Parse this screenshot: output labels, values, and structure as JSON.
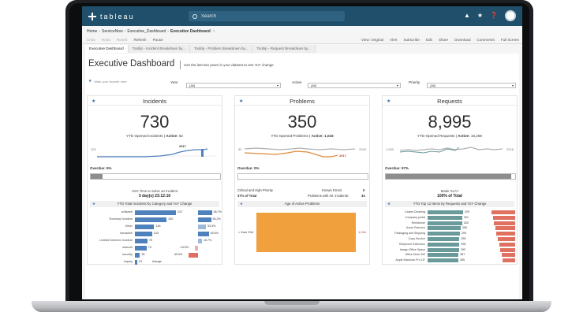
{
  "app": {
    "logo_text": "tableau",
    "search_placeholder": "Search"
  },
  "breadcrumb": [
    "Home",
    "ServiceNow",
    "Executive_Dashboard",
    "Executive Dashboard"
  ],
  "toolbar": {
    "left": [
      "Undo",
      "Redo",
      "Revert",
      "Refresh",
      "Pause"
    ],
    "right": [
      "View: Original",
      "Alert",
      "Subscribe",
      "Edit",
      "Share",
      "Download",
      "Comments",
      "Full Screen"
    ]
  },
  "tabs": [
    "Executive Dashboard",
    "Tooltip - Incident Breakdown by...",
    "Tooltip - Problem Breakdown by...",
    "Tooltip - Request Breakdown by..."
  ],
  "dashboard": {
    "title": "Executive Dashboard",
    "subtitle": "Use the last two years in your dataset to see YoY change",
    "hint": "Mark your favorite view",
    "filters": [
      {
        "label": "Year",
        "value": "(All)"
      },
      {
        "label": "Active",
        "value": "(All)"
      },
      {
        "label": "Priority",
        "value": "(All)"
      }
    ]
  },
  "incidents": {
    "title": "Incidents",
    "value": "730",
    "ytd_label": "YTD Opened Incidents",
    "active_label": "Active:",
    "active_value": "62",
    "year_label": "2017",
    "axis_left": "100",
    "overdue_label": "Overdue:",
    "overdue_value": "9%",
    "overdue_fraction": 0.09,
    "avg_label": "AVG Time to Solve an Incident",
    "avg_value": "3 day(s) 23:12:16",
    "chart_title": "YTD Total Incidents by Category and YoY Change",
    "categories": [
      {
        "name": "software",
        "value": "247",
        "yoy": "58.7%",
        "n": 247,
        "y": 58.7
      },
      {
        "name": "Technical Incident",
        "value": "190",
        "yoy": "55.2%",
        "n": 190,
        "y": 55.2
      },
      {
        "name": "Other",
        "value": "116",
        "yoy": "33.3%",
        "n": 116,
        "y": 33.3
      },
      {
        "name": "hardware",
        "value": "103",
        "yoy": "45.5%",
        "n": 103,
        "y": 45.5
      },
      {
        "name": "Limited Deemed Incident",
        "value": "75",
        "yoy": "16.7%",
        "n": 75,
        "y": 16.7
      },
      {
        "name": "network",
        "value": "70",
        "yoy": "-14.5%",
        "n": 70,
        "y": -14.5
      },
      {
        "name": "security",
        "value": "30",
        "yoy": "-40.5%",
        "n": 30,
        "y": -40.5
      },
      {
        "name": "inquiry",
        "value": "13",
        "yoy": "",
        "n": 13,
        "y": 0
      }
    ],
    "avg_tag": "Average"
  },
  "problems": {
    "title": "Problems",
    "value": "350",
    "ytd_label": "YTD Opened Problems",
    "active_label": "Active:",
    "active_value": "1,016",
    "year_label": "2017",
    "axis_left": "50",
    "axis_right": "2016",
    "overdue_label": "Overdue:",
    "overdue_value": "0%",
    "overdue_fraction": 0.0,
    "crit_label": "Critical and High Priority",
    "crit_value": "37% of Total",
    "known_label": "Known Errors",
    "known_value": "0",
    "rel_label": "Problems with rel. incidents:",
    "rel_value": "34",
    "age_title": "Age of Active Problems",
    "age_bucket": "> than 90d",
    "age_value": "1,016"
  },
  "requests": {
    "title": "Requests",
    "value": "8,995",
    "ytd_label": "YTD Opened Requests",
    "active_label": "Active:",
    "active_value": "16,258",
    "axis_left": "1,000",
    "axis_right": "2016",
    "overdue_label": "Overdue:",
    "overdue_value": "97%",
    "overdue_fraction": 0.97,
    "made_label": "Made SLA?",
    "made_value": "100% of Total",
    "chart_title": "YTD Top 12 Items by Requests and YoY Change",
    "items": [
      {
        "name": "Carpet Cleaning",
        "value": "329",
        "n": 329
      },
      {
        "name": "Company portal",
        "value": "321",
        "n": 321
      },
      {
        "name": "Reimburse",
        "value": "320",
        "n": 320
      },
      {
        "name": "Azure Eservice",
        "value": "306",
        "n": 306
      },
      {
        "name": "Packaging and Shipping",
        "value": "299",
        "n": 299
      },
      {
        "name": "Copy Service",
        "value": "295",
        "n": 295
      },
      {
        "name": "Telephone Extension",
        "value": "295",
        "n": 295
      },
      {
        "name": "Assign Office Space",
        "value": "293",
        "n": 293
      },
      {
        "name": "Office Desk Sell",
        "value": "287",
        "n": 287
      },
      {
        "name": "Apple Macbook Pro 15\"",
        "value": "285",
        "n": 285
      }
    ]
  },
  "colors": {
    "topbar": "#1f4f6b",
    "accent": "#3d6ea6",
    "bar_blue": "#4f81bd",
    "orange": "#f0a03c",
    "teal": "#6a9a9a",
    "red": "#e07060"
  }
}
